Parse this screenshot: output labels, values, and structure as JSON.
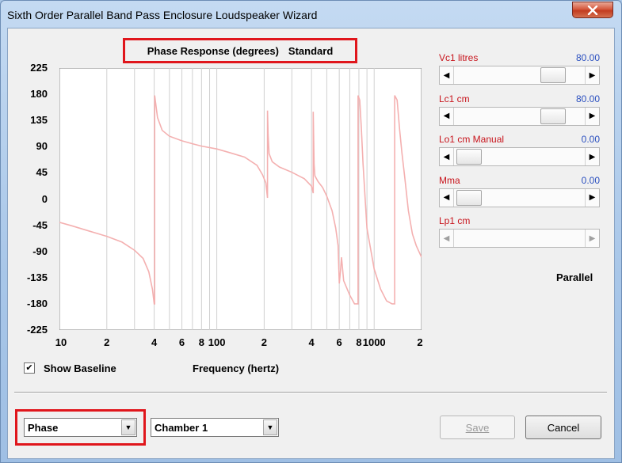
{
  "window": {
    "title": "Sixth Order Parallel Band Pass Enclosure Loudspeaker Wizard",
    "close_icon": "close-icon"
  },
  "graph": {
    "title_left": "Phase Response (degrees)",
    "title_right": "Standard",
    "x_axis_label": "Frequency (hertz)",
    "show_baseline_label": "Show Baseline",
    "show_baseline_checked": true,
    "curve_color": "#f4b0b0"
  },
  "chart_data": {
    "type": "line",
    "title": "Phase Response (degrees)",
    "xlabel": "Frequency (hertz)",
    "ylabel": "",
    "xscale": "log",
    "xlim": [
      10,
      2000
    ],
    "ylim": [
      -225,
      225
    ],
    "x_tick_labels": [
      "10",
      "2",
      "4",
      "6",
      "8",
      "100",
      "2",
      "4",
      "6",
      "8",
      "1000",
      "2"
    ],
    "y_tick_labels": [
      "225",
      "180",
      "135",
      "90",
      "45",
      "0",
      "-45",
      "-90",
      "-135",
      "-180",
      "-225"
    ],
    "series": [
      {
        "values_note": "phase",
        "x": [
          10,
          12,
          15,
          20,
          25,
          30,
          34,
          37,
          39,
          40,
          40.3,
          40.3,
          42,
          45,
          50,
          60,
          70,
          80,
          100,
          120,
          150,
          180,
          195,
          205,
          210,
          210,
          212,
          215,
          225,
          250,
          300,
          360,
          400,
          410,
          410,
          415,
          420,
          440,
          470,
          500,
          540,
          570,
          590,
          600,
          610,
          620,
          640,
          700,
          750,
          780,
          790,
          790,
          810,
          830,
          850,
          900,
          1000,
          1100,
          1200,
          1300,
          1350,
          1350,
          1400,
          1450,
          1500,
          1560,
          1650,
          1750,
          1850,
          2000
        ],
        "y": [
          -40,
          -46,
          -54,
          -64,
          -74,
          -88,
          -102,
          -125,
          -155,
          -180,
          -180,
          178,
          140,
          118,
          108,
          100,
          95,
          91,
          86,
          80,
          72,
          58,
          42,
          28,
          2,
          152,
          110,
          78,
          64,
          55,
          46,
          35,
          22,
          10,
          150,
          60,
          40,
          30,
          20,
          5,
          -20,
          -50,
          -80,
          -145,
          -125,
          -100,
          -140,
          -165,
          -180,
          -180,
          -180,
          178,
          170,
          120,
          60,
          -50,
          -120,
          -155,
          -175,
          -180,
          -180,
          178,
          170,
          120,
          80,
          40,
          -20,
          -60,
          -80,
          -100
        ]
      }
    ]
  },
  "params": [
    {
      "label": "Vc1  litres",
      "value": "80.00",
      "thumb_pos": 0.82,
      "disabled": false
    },
    {
      "label": "Lc1  cm",
      "value": "80.00",
      "thumb_pos": 0.82,
      "disabled": false
    },
    {
      "label": "Lo1  cm  Manual",
      "value": "0.00",
      "thumb_pos": 0.02,
      "disabled": false
    },
    {
      "label": "Mma",
      "value": "0.00",
      "thumb_pos": 0.02,
      "disabled": false
    },
    {
      "label": "Lp1  cm",
      "value": "",
      "thumb_pos": 0.0,
      "disabled": true
    }
  ],
  "configuration_label": "Parallel",
  "bottom": {
    "response_select": "Phase",
    "chamber_select": "Chamber 1",
    "save_label": "Save",
    "cancel_label": "Cancel"
  }
}
